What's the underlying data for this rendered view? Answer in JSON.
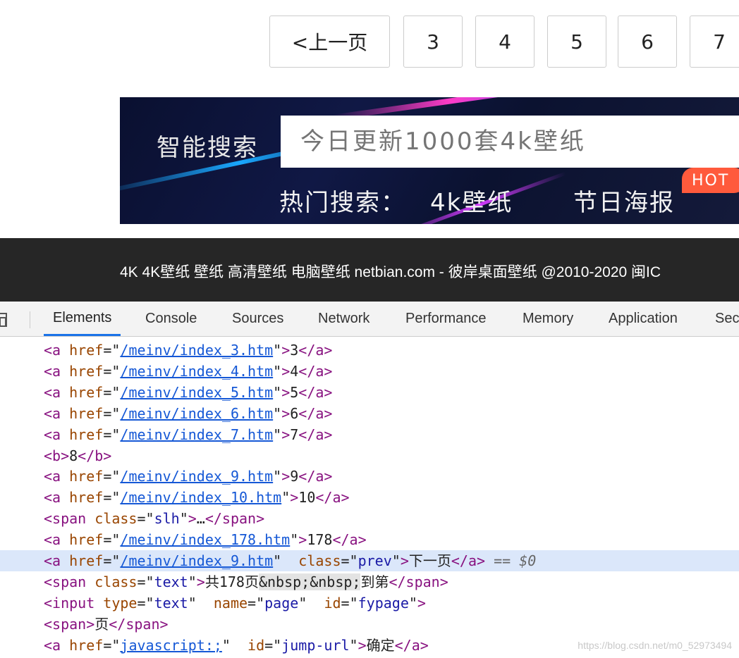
{
  "pagination": {
    "prev_label": "<上一页",
    "pages": [
      "3",
      "4",
      "5",
      "6",
      "7"
    ]
  },
  "banner": {
    "search_label": "智能搜索",
    "search_placeholder": "今日更新1000套4k壁纸",
    "hot_label": "热门搜索：",
    "hot_links": [
      "4k壁纸",
      "节日海报"
    ],
    "hot_badge": "HOT"
  },
  "footer": {
    "text": "4K 4K壁纸 壁纸 高清壁纸 电脑壁纸 netbian.com - 彼岸桌面壁纸 @2010-2020 闽IC"
  },
  "devtools": {
    "tabs": [
      "Elements",
      "Console",
      "Sources",
      "Network",
      "Performance",
      "Memory",
      "Application",
      "Sec"
    ],
    "active_tab": "Elements",
    "lines": [
      {
        "type": "a",
        "href": "/meinv/index_3.htm",
        "text": "3"
      },
      {
        "type": "a",
        "href": "/meinv/index_4.htm",
        "text": "4"
      },
      {
        "type": "a",
        "href": "/meinv/index_5.htm",
        "text": "5"
      },
      {
        "type": "a",
        "href": "/meinv/index_6.htm",
        "text": "6"
      },
      {
        "type": "a",
        "href": "/meinv/index_7.htm",
        "text": "7"
      },
      {
        "type": "b",
        "text": "8"
      },
      {
        "type": "a",
        "href": "/meinv/index_9.htm",
        "text": "9"
      },
      {
        "type": "a",
        "href": "/meinv/index_10.htm",
        "text": "10"
      },
      {
        "type": "span",
        "class": "slh",
        "text": "…"
      },
      {
        "type": "a",
        "href": "/meinv/index_178.htm",
        "text": "178"
      },
      {
        "type": "a-class",
        "href": "/meinv/index_9.htm",
        "class": "prev",
        "text": "下一页",
        "suffix": "== $0",
        "selected": true
      },
      {
        "type": "span-text",
        "class": "text",
        "text_before": "共178页",
        "entity": "&nbsp;&nbsp;",
        "text_after": "到第"
      },
      {
        "type": "input",
        "input_type": "text",
        "name": "page",
        "id": "fypage"
      },
      {
        "type": "span",
        "text": "页"
      },
      {
        "type": "a-id",
        "href": "javascript:;",
        "id": "jump-url",
        "text": "确定"
      }
    ]
  },
  "watermark": "https://blog.csdn.net/m0_52973494"
}
